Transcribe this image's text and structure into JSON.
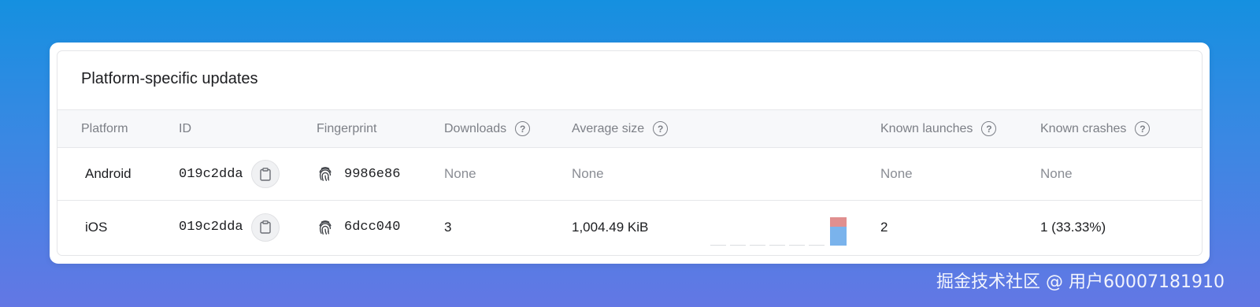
{
  "card": {
    "title": "Platform-specific updates"
  },
  "columns": {
    "platform": "Platform",
    "id": "ID",
    "fingerprint": "Fingerprint",
    "downloads": "Downloads",
    "average_size": "Average size",
    "known_launches": "Known launches",
    "known_crashes": "Known crashes"
  },
  "rows": [
    {
      "platform": "Android",
      "id": "019c2dda",
      "fingerprint": "9986e86",
      "downloads": "None",
      "average_size": "None",
      "known_launches": "None",
      "known_crashes": "None"
    },
    {
      "platform": "iOS",
      "id": "019c2dda",
      "fingerprint": "6dcc040",
      "downloads": "3",
      "average_size": "1,004.49 KiB",
      "known_launches": "2",
      "known_crashes": "1 (33.33%)",
      "size_chart": {
        "crashed_share": 0.33,
        "ok_share": 0.67
      }
    }
  ],
  "icons": {
    "copy": "clipboard-icon",
    "fingerprint": "fingerprint-icon",
    "help": "help-circle-icon"
  },
  "colors": {
    "crash_bar": "#e08f8f",
    "launch_bar": "#7ab3ec"
  },
  "watermark": "掘金技术社区 @ 用户60007181910"
}
